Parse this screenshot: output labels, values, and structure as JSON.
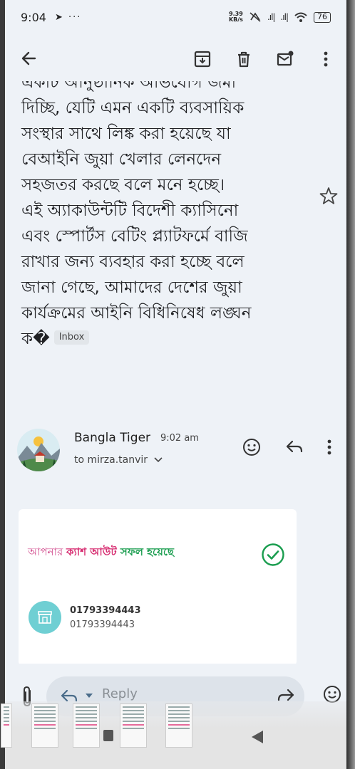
{
  "status_bar": {
    "time": "9:04",
    "left_icons": "➤ ···",
    "net_speed_value": "9.39",
    "net_speed_unit": "KB/s",
    "battery": "76"
  },
  "toolbar": {
    "back_icon": "arrow-left-icon",
    "archive_icon": "archive-icon",
    "delete_icon": "trash-icon",
    "unread_icon": "mark-unread-icon",
    "more_icon": "more-vert-icon"
  },
  "message": {
    "partial_first_line": "একটি আনুষ্ঠানিক অভিযোগ জমা",
    "lines": [
      "দিচ্ছি, যেটি এমন একটি ব্যবসায়িক",
      "সংস্থার সাথে লিঙ্ক করা হয়েছে যা",
      "বেআইনি জুয়া খেলার লেনদেন",
      "সহজতর করছে বলে মনে হচ্ছে।",
      "এই অ্যাকাউন্টটি বিদেশী ক্যাসিনো",
      "এবং স্পোর্টস বেটিং প্ল্যাটফর্মে বাজি",
      "রাখার জন্য ব্যবহার করা হচ্ছে বলে",
      "জানা গেছে, আমাদের দেশের জুয়া",
      "কার্যক্রমের আইনি বিধিনিষেধ লঙ্ঘন"
    ],
    "last_line": "ক�",
    "label_badge": "Inbox"
  },
  "sender": {
    "name": "Bangla Tiger",
    "time": "9:02 am",
    "to": "to mirza.tanvir"
  },
  "card": {
    "title_part1": "আপনার ",
    "title_part2": "ক্যাশ আউট",
    "title_part3": " সফল হয়েছে",
    "account_primary": "01793394443",
    "account_secondary": "01793394443"
  },
  "reply_bar": {
    "placeholder": "Reply"
  },
  "colors": {
    "background": "#eef2f7",
    "accent_pink": "#d62a6f",
    "accent_green": "#1a9d4f",
    "store_icon_bg": "#6fcfd3"
  }
}
